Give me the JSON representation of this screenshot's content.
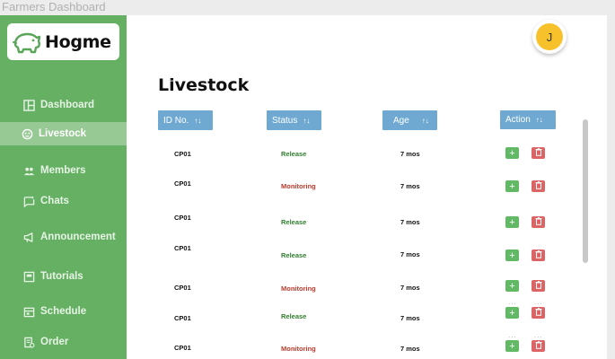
{
  "window": {
    "title": "Farmers Dashboard"
  },
  "brand": {
    "name": "Hogme",
    "logo_icon": "pig-icon"
  },
  "user": {
    "initial": "J"
  },
  "sidebar": {
    "items": [
      {
        "label": "Dashboard",
        "icon": "dashboard-icon"
      },
      {
        "label": "Livestock",
        "icon": "livestock-icon",
        "active": true
      },
      {
        "label": "Members",
        "icon": "members-icon"
      },
      {
        "label": "Chats",
        "icon": "chats-icon"
      },
      {
        "label": "Announcement",
        "icon": "announcement-icon"
      },
      {
        "label": "Tutorials",
        "icon": "tutorials-icon"
      },
      {
        "label": "Schedule",
        "icon": "schedule-icon"
      },
      {
        "label": "Order",
        "icon": "order-icon"
      }
    ]
  },
  "main": {
    "title": "Livestock",
    "columns": [
      {
        "label": "ID No.",
        "sort_icon": "↑↓"
      },
      {
        "label": "Status",
        "sort_icon": "↑↓"
      },
      {
        "label": "Age",
        "sort_icon": "↑↓"
      },
      {
        "label": "Action",
        "sort_icon": "↑↓"
      }
    ],
    "rows": [
      {
        "id": "CP01",
        "status": "Release",
        "age": "7 mos"
      },
      {
        "id": "CP01",
        "status": "Monitoring",
        "age": "7 mos"
      },
      {
        "id": "CP01",
        "status": "Release",
        "age": "7 mos"
      },
      {
        "id": "CP01",
        "status": "Release",
        "age": "7 mos"
      },
      {
        "id": "CP01",
        "status": "Monitoring",
        "age": "7 mos"
      },
      {
        "id": "CP01",
        "status": "Release",
        "age": "7 mos"
      },
      {
        "id": "CP01",
        "status": "Monitoring",
        "age": "7 mos"
      }
    ],
    "add_label": "+",
    "dots": "...",
    "colors": {
      "release": "#2f7d2d",
      "monitoring": "#c0392b",
      "header": "#6fa9d2",
      "sidebar": "#66b064"
    }
  }
}
